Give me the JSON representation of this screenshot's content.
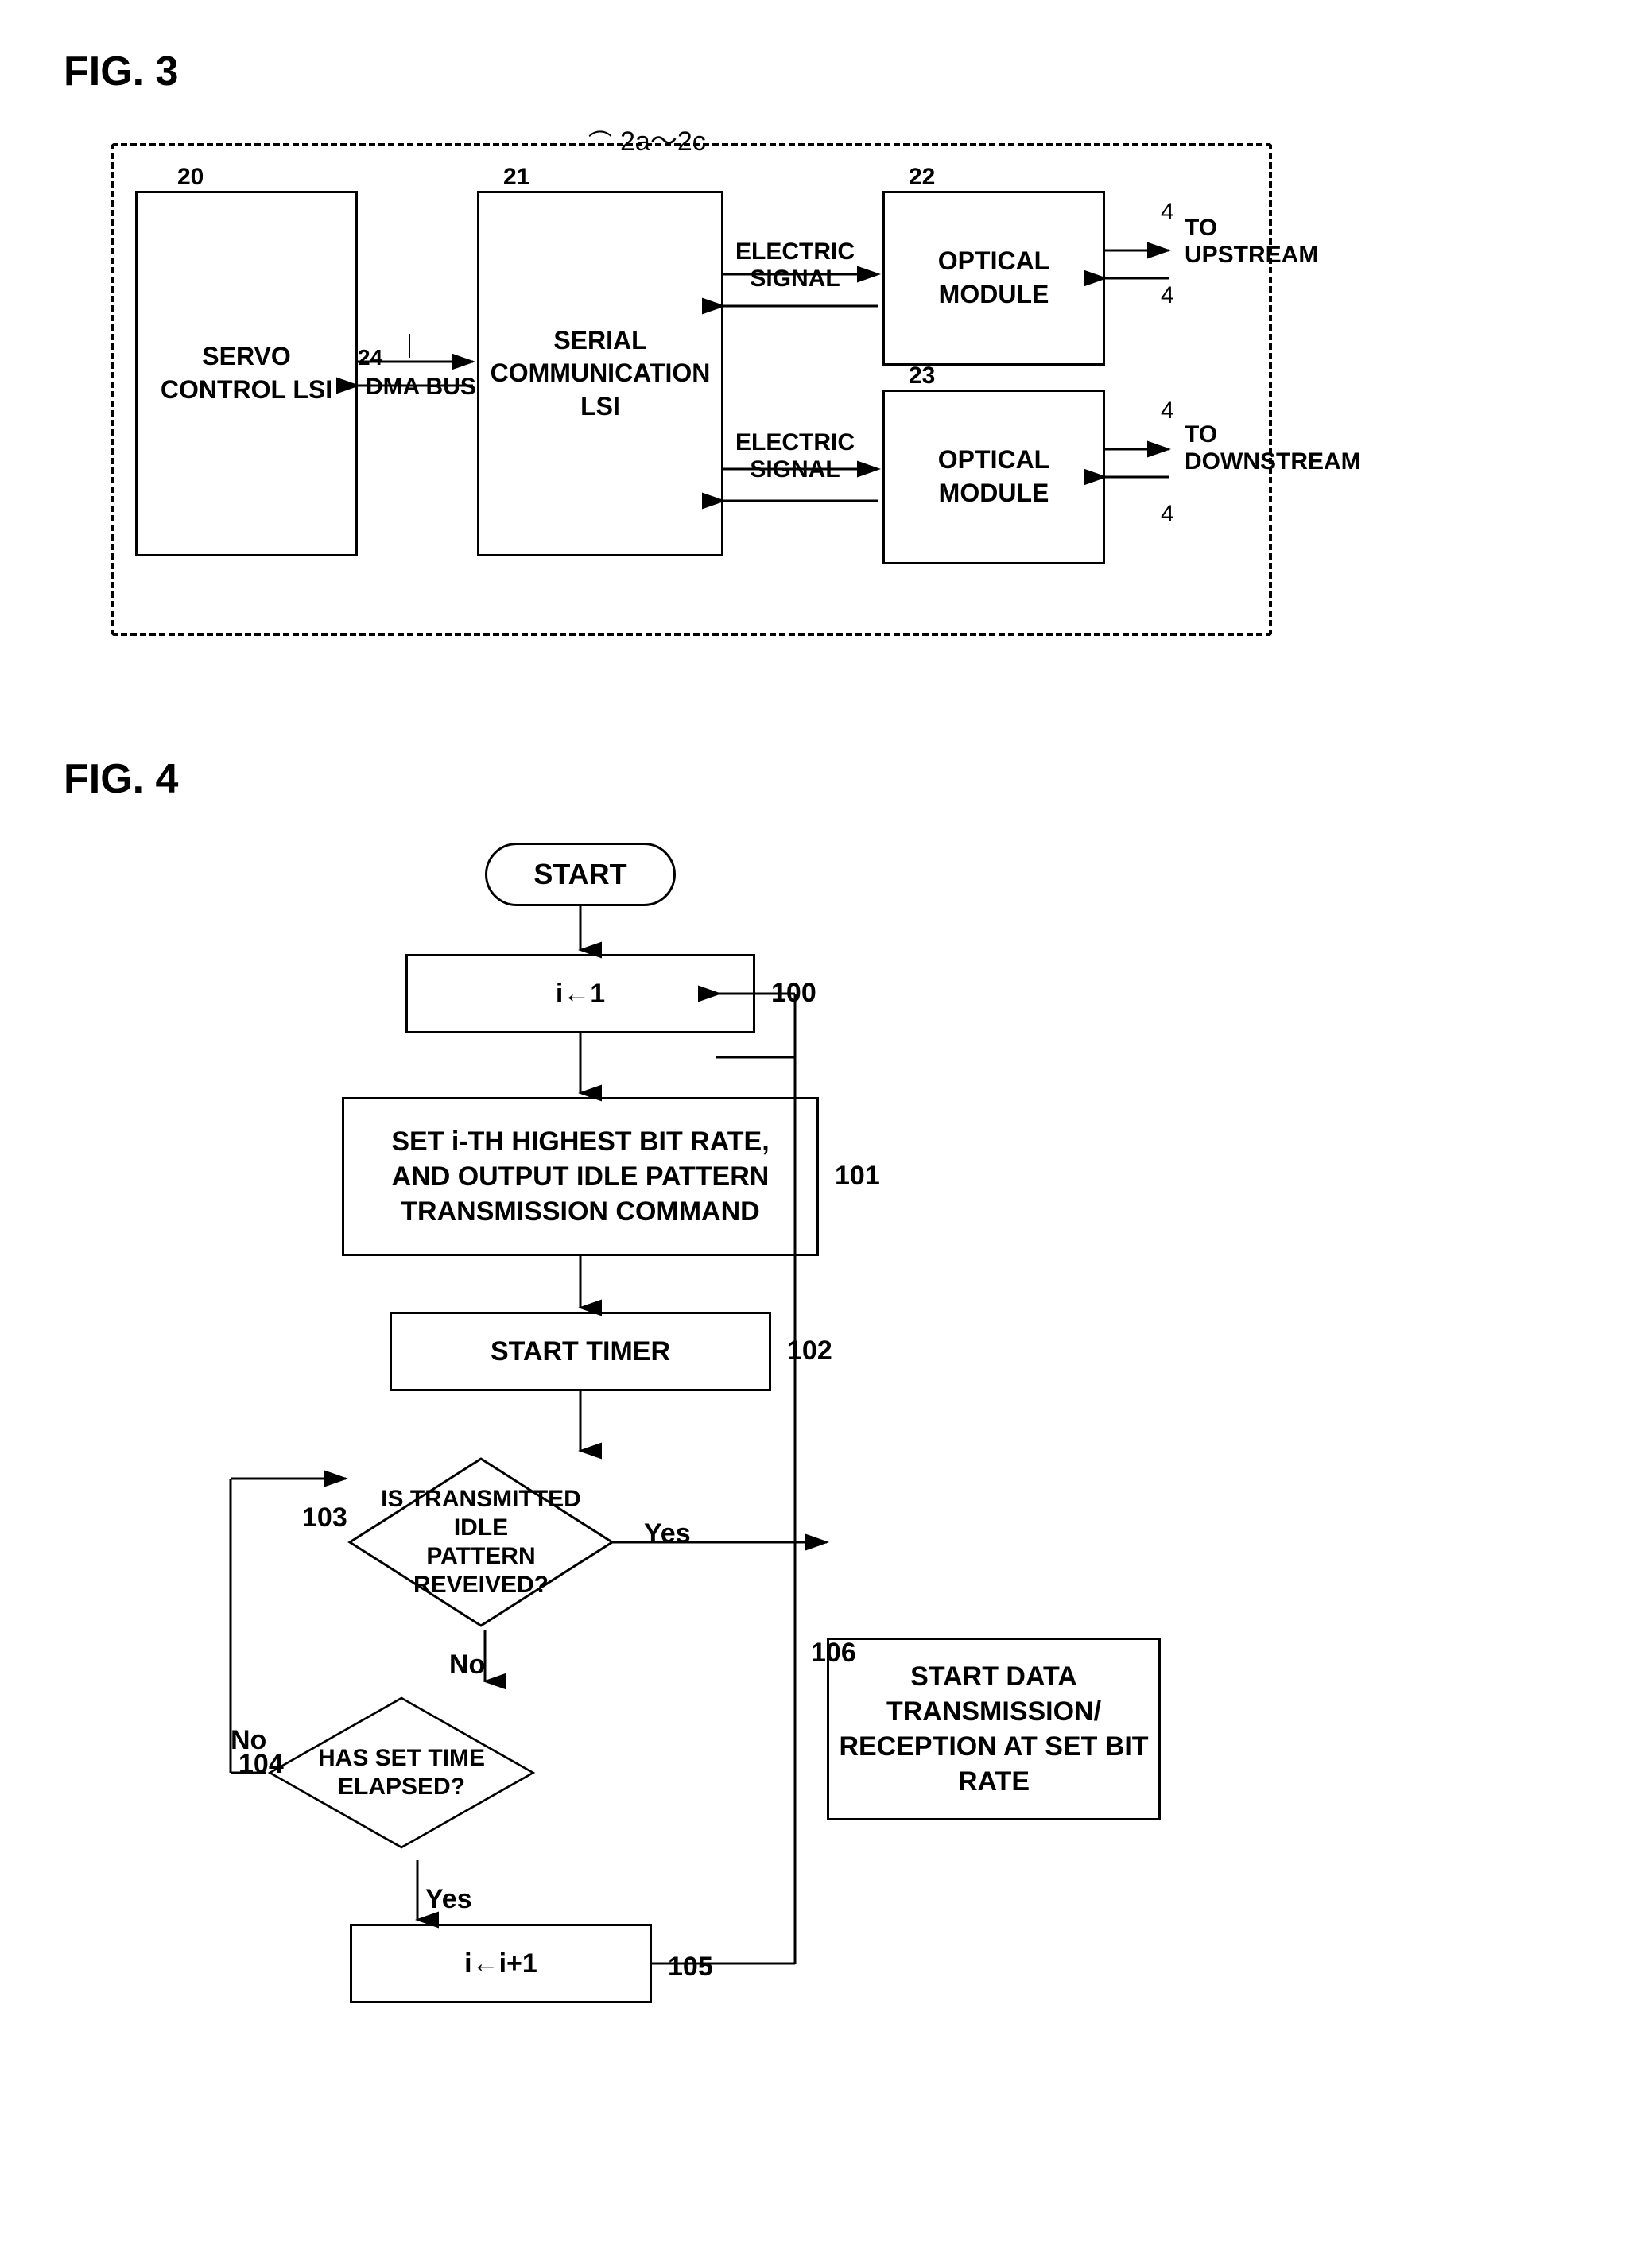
{
  "fig3": {
    "label": "FIG. 3",
    "annotation_main": "2a～2c",
    "blocks": {
      "servo": {
        "label": "SERVO\nCONTROL LSI",
        "number": "20"
      },
      "serial": {
        "label": "SERIAL\nCOMMUNICATION\nLSI",
        "number": "21"
      },
      "optical_up": {
        "label": "OPTICAL\nMODULE",
        "number": "22"
      },
      "optical_down": {
        "label": "OPTICAL\nMODULE",
        "number": "23"
      },
      "dma": {
        "label": "DMA BUS",
        "number": "24"
      },
      "electric_up": {
        "label": "ELECTRIC\nSIGNAL"
      },
      "electric_down": {
        "label": "ELECTRIC\nSIGNAL"
      },
      "to_upstream": {
        "label": "TO\nUPSTREAM"
      },
      "to_downstream": {
        "label": "TO\nDOWNSTREAM"
      },
      "port_numbers": [
        "4",
        "4",
        "4",
        "4"
      ]
    }
  },
  "fig4": {
    "label": "FIG. 4",
    "nodes": {
      "start": {
        "label": "START"
      },
      "init": {
        "label": "i←1",
        "number": "100"
      },
      "set_bit": {
        "label": "SET i-TH HIGHEST BIT RATE,\nAND OUTPUT IDLE PATTERN\nTRANSMISSION COMMAND",
        "number": "101"
      },
      "start_timer": {
        "label": "START TIMER",
        "number": "102"
      },
      "is_received": {
        "label": "IS TRANSMITTED IDLE\nPATTERN REVEIVED?",
        "number": "103"
      },
      "has_elapsed": {
        "label": "HAS SET TIME ELAPSED?",
        "number": "104"
      },
      "increment": {
        "label": "i←i+1",
        "number": "105"
      },
      "start_data": {
        "label": "START DATA\nTRANSMISSION/\nRECEPTION AT SET BIT\nRATE",
        "number": "106"
      }
    },
    "labels": {
      "yes": "Yes",
      "no": "No",
      "no2": "No",
      "yes2": "Yes"
    }
  }
}
